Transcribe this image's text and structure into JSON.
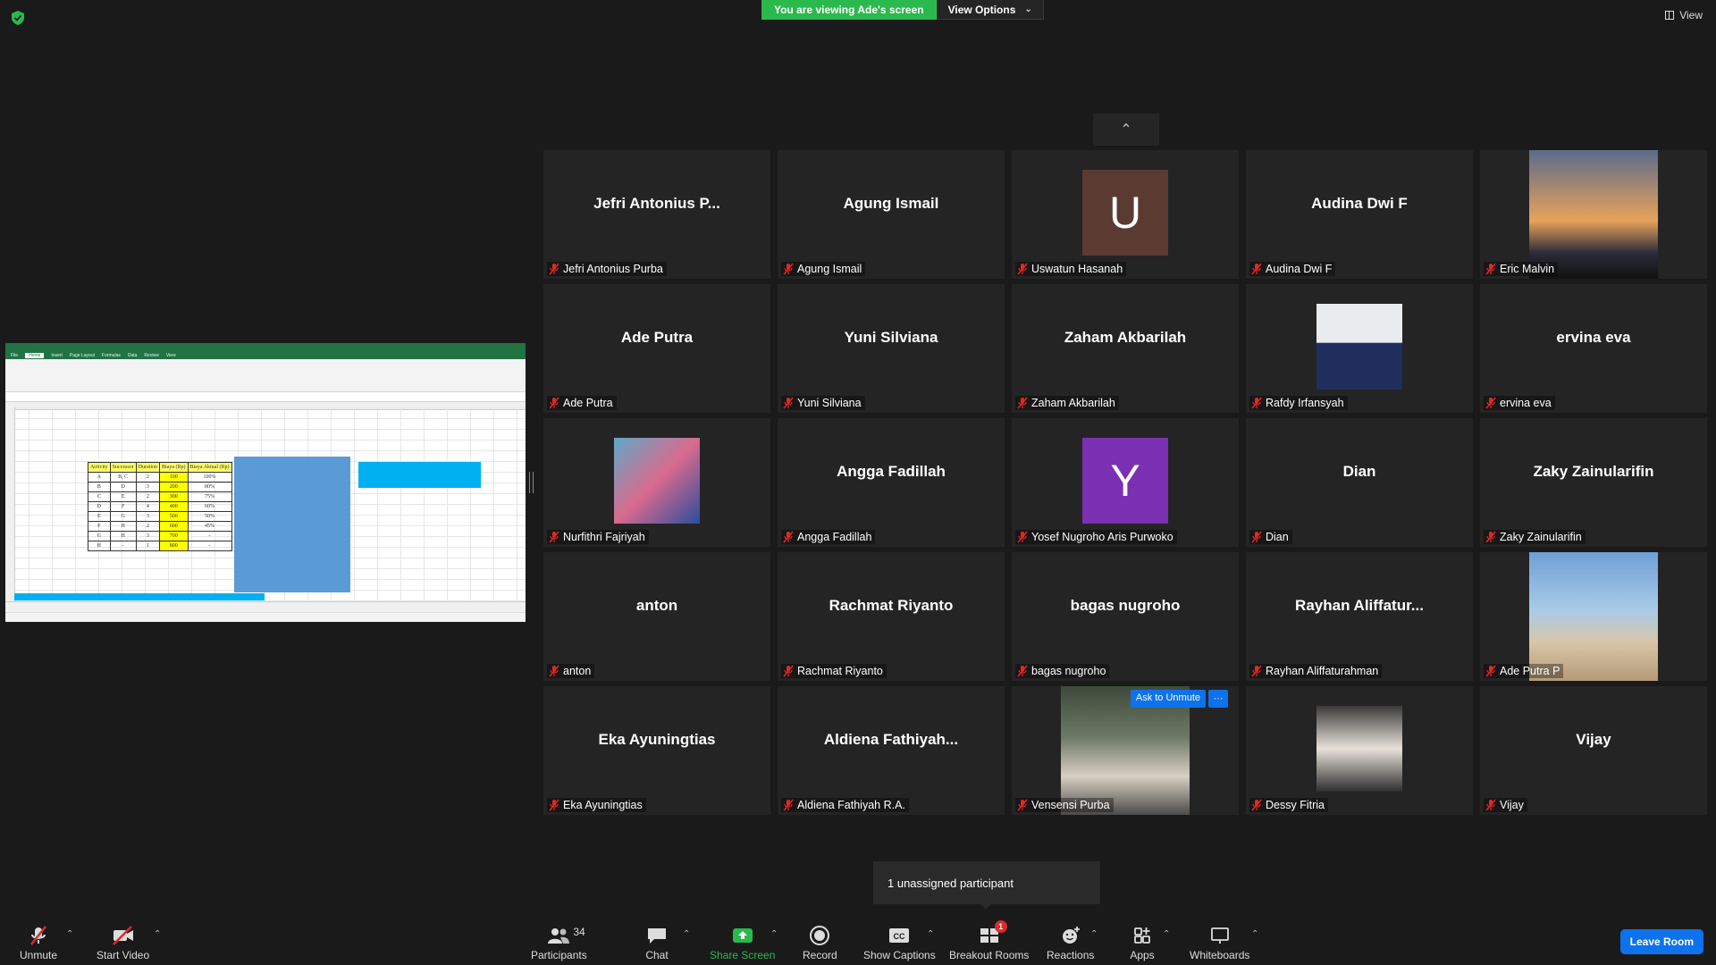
{
  "top": {
    "viewing_banner": "You are viewing Ade's screen",
    "view_options": "View Options",
    "view_label": "View"
  },
  "tiles": [
    {
      "big": "Jefri Antonius P...",
      "label": "Jefri Antonius Purba",
      "kind": "text"
    },
    {
      "big": "Agung Ismail",
      "label": "Agung Ismail",
      "kind": "text"
    },
    {
      "big": "U",
      "label": "Uswatun Hasanah",
      "kind": "letter",
      "color": "#5b3a32"
    },
    {
      "big": "Audina Dwi F",
      "label": "Audina Dwi F",
      "kind": "text"
    },
    {
      "big": "",
      "label": "Eric Malvin",
      "kind": "photo-tall"
    },
    {
      "big": "Ade Putra",
      "label": "Ade Putra",
      "kind": "text"
    },
    {
      "big": "Yuni Silviana",
      "label": "Yuni Silviana",
      "kind": "text"
    },
    {
      "big": "Zaham Akbarilah",
      "label": "Zaham Akbarilah",
      "kind": "text"
    },
    {
      "big": "",
      "label": "Rafdy Irfansyah",
      "kind": "photo"
    },
    {
      "big": "ervina eva",
      "label": "ervina eva",
      "kind": "text"
    },
    {
      "big": "",
      "label": "Nurfithri Fajriyah",
      "kind": "photo"
    },
    {
      "big": "Angga Fadillah",
      "label": "Angga Fadillah",
      "kind": "text"
    },
    {
      "big": "Y",
      "label": "Yosef Nugroho Aris Purwoko",
      "kind": "letter",
      "color": "#7b2fb3"
    },
    {
      "big": "Dian",
      "label": "Dian",
      "kind": "text"
    },
    {
      "big": "Zaky Zainularifin",
      "label": "Zaky Zainularifin",
      "kind": "text"
    },
    {
      "big": "anton",
      "label": "anton",
      "kind": "text"
    },
    {
      "big": "Rachmat Riyanto",
      "label": "Rachmat Riyanto",
      "kind": "text"
    },
    {
      "big": "bagas nugroho",
      "label": "bagas nugroho",
      "kind": "text"
    },
    {
      "big": "Rayhan  Aliffatur...",
      "label": "Rayhan Aliffaturahman",
      "kind": "text"
    },
    {
      "big": "",
      "label": "Ade Putra P",
      "kind": "photo-tall"
    },
    {
      "big": "Eka Ayuningtias",
      "label": "Eka Ayuningtias",
      "kind": "text"
    },
    {
      "big": "Aldiena  Fathiyah...",
      "label": "Aldiena Fathiyah R.A.",
      "kind": "text"
    },
    {
      "big": "",
      "label": "Vensensi Purba",
      "kind": "photo-tall",
      "ask": "Ask to Unmute",
      "more": "···"
    },
    {
      "big": "",
      "label": "Dessy Fitria",
      "kind": "photo"
    },
    {
      "big": "Vijay",
      "label": "Vijay",
      "kind": "text"
    }
  ],
  "unassigned": "1 unassigned participant",
  "toolbar": {
    "unmute": "Unmute",
    "start_video": "Start Video",
    "participants": "Participants",
    "participants_count": "34",
    "chat": "Chat",
    "share_screen": "Share Screen",
    "record": "Record",
    "show_captions": "Show Captions",
    "breakout_rooms": "Breakout Rooms",
    "breakout_badge": "1",
    "reactions": "Reactions",
    "apps": "Apps",
    "whiteboards": "Whiteboards",
    "leave_room": "Leave Room"
  },
  "shared_sheet": {
    "headers": [
      "Activity",
      "Successor",
      "Duration",
      "Biaya (Rp)",
      "Biaya Aktual (Rp)"
    ],
    "rows": [
      [
        "A",
        "B, C",
        "2",
        "100",
        "100%"
      ],
      [
        "B",
        "D",
        "3",
        "200",
        "80%"
      ],
      [
        "C",
        "E",
        "2",
        "300",
        "75%"
      ],
      [
        "D",
        "F",
        "4",
        "400",
        "60%"
      ],
      [
        "E",
        "G",
        "3",
        "500",
        "50%"
      ],
      [
        "F",
        "H",
        "2",
        "600",
        "45%"
      ],
      [
        "G",
        "H",
        "3",
        "700",
        "-"
      ],
      [
        "H",
        "-",
        "1",
        "800",
        "-"
      ]
    ]
  },
  "colors": {
    "banner_green": "#2ab94d",
    "zoom_blue": "#0e72ed",
    "tile_bg": "#242424",
    "excel_green": "#217346"
  }
}
